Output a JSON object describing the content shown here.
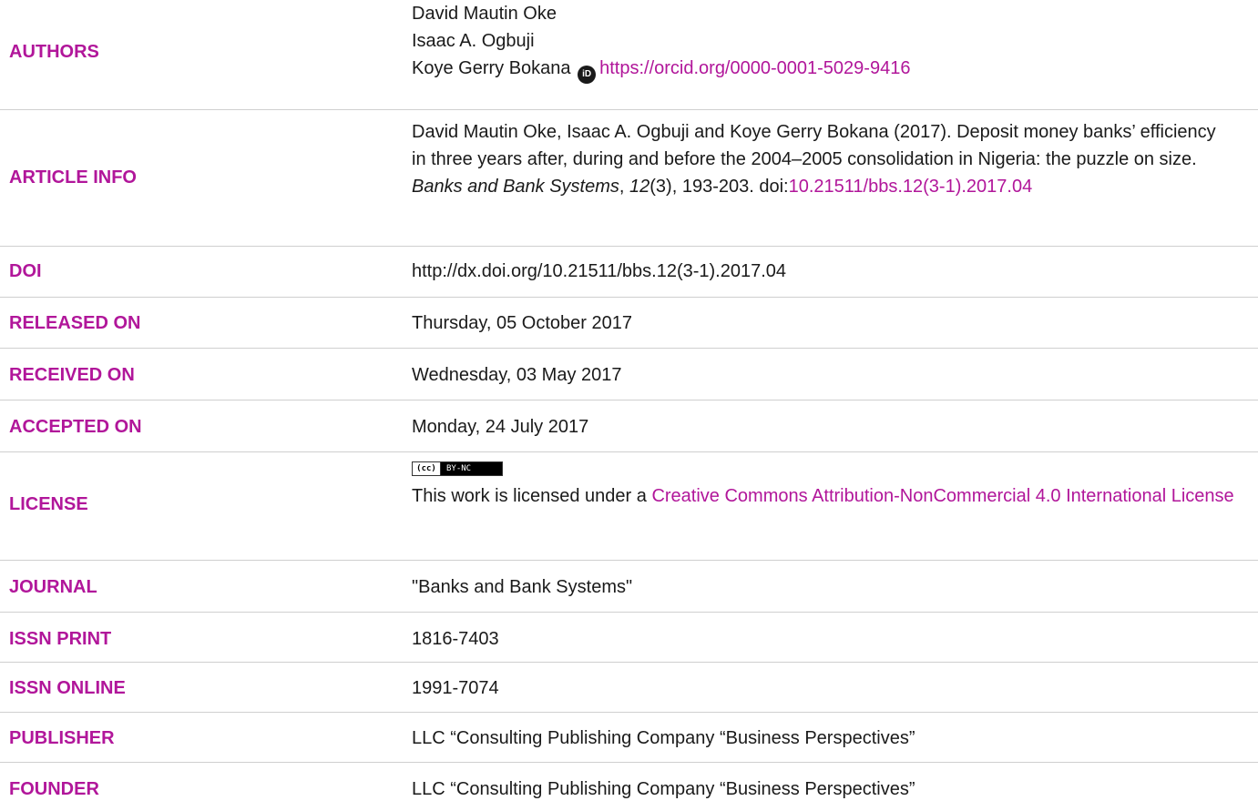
{
  "authors": {
    "label": "AUTHORS",
    "names": [
      "David Mautin Oke",
      "Isaac A. Ogbuji",
      "Koye Gerry Bokana"
    ],
    "orcid_url": "https://orcid.org/0000-0001-5029-9416",
    "orcid_icon": "orcid-icon"
  },
  "article_info": {
    "label": "ARTICLE INFO",
    "citation_prefix": "David Mautin Oke, Isaac A. Ogbuji and Koye Gerry Bokana (2017). Deposit money banks’ efficiency in three years after, during and before the 2004–2005 consolidation in Nigeria: the puzzle on size. ",
    "journal_italic": "Banks and Bank Systems",
    "comma1": ", ",
    "volume_italic": "12",
    "issue_pages": "(3), 193-203. doi:",
    "doi_link": "10.21511/bbs.12(3-1).2017.04"
  },
  "doi": {
    "label": "DOI",
    "value": "http://dx.doi.org/10.21511/bbs.12(3-1).2017.04"
  },
  "released_on": {
    "label": "RELEASED ON",
    "value": "Thursday, 05 October 2017"
  },
  "received_on": {
    "label": "RECEIVED ON",
    "value": "Wednesday, 03 May 2017"
  },
  "accepted_on": {
    "label": "ACCEPTED ON",
    "value": "Monday, 24 July 2017"
  },
  "license": {
    "label": "LICENSE",
    "badge_cc": "(cc)",
    "badge_text": "BY-NC",
    "text_prefix": "This work is licensed under a ",
    "link_text": "Creative Commons Attribution-NonCommercial 4.0 International License"
  },
  "journal": {
    "label": "JOURNAL",
    "value": "\"Banks and Bank Systems\""
  },
  "issn_print": {
    "label": "ISSN PRINT",
    "value": "1816-7403"
  },
  "issn_online": {
    "label": "ISSN ONLINE",
    "value": "1991-7074"
  },
  "publisher": {
    "label": "PUBLISHER",
    "value": "LLC “Consulting Publishing Company “Business Perspectives”"
  },
  "founder": {
    "label": "FOUNDER",
    "value": "LLC “Consulting Publishing Company “Business Perspectives”"
  },
  "colors": {
    "accent": "#b1169a",
    "text": "#1a1a1a",
    "divider": "#cfcfcf"
  }
}
